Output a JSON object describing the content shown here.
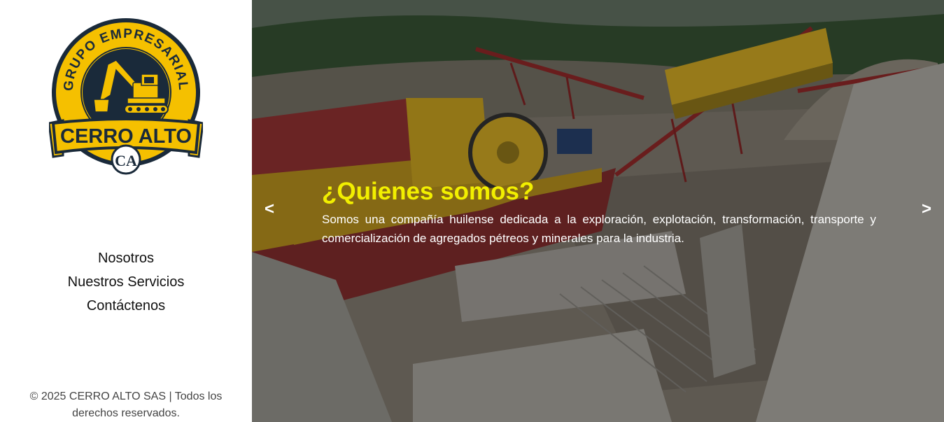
{
  "logo": {
    "arc_text": "GRUPO EMPRESARIAL",
    "banner_text": "CERRO ALTO",
    "monogram": "CA",
    "colors": {
      "yellow": "#f5c000",
      "navy": "#1a2a3a",
      "white": "#ffffff"
    }
  },
  "nav": {
    "items": [
      {
        "label": "Nosotros"
      },
      {
        "label": "Nuestros Servicios"
      },
      {
        "label": "Contáctenos"
      }
    ]
  },
  "footer": {
    "text": "© 2025 CERRO ALTO SAS | Todos los derechos reservados."
  },
  "hero": {
    "title": "¿Quienes somos?",
    "description": "Somos una compañía huilense dedicada a la exploración, explotación, transformación, transporte y comercialización de agregados pétreos y minerales para la industria.",
    "prev_label": "<",
    "next_label": ">",
    "title_color": "#f2ef00"
  }
}
